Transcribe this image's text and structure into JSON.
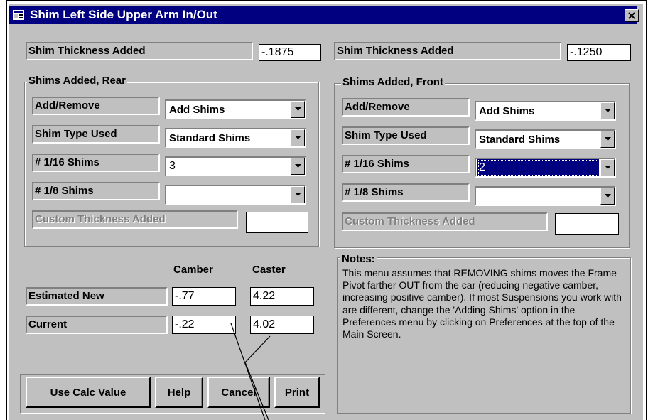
{
  "window": {
    "title": "Shim Left Side Upper Arm In/Out"
  },
  "rear": {
    "thickness_label": "Shim Thickness Added",
    "thickness_value": "-.1875",
    "group_title": "Shims Added, Rear",
    "add_remove_label": "Add/Remove",
    "add_remove_value": "Add Shims",
    "shim_type_label": "Shim Type Used",
    "shim_type_value": "Standard Shims",
    "sixteenth_label": "# 1/16 Shims",
    "sixteenth_value": "3",
    "eighth_label": "# 1/8 Shims",
    "eighth_value": "",
    "custom_label": "Custom Thickness Added",
    "custom_value": ""
  },
  "front": {
    "thickness_label": "Shim Thickness Added",
    "thickness_value": "-.1250",
    "group_title": "Shims Added, Front",
    "add_remove_label": "Add/Remove",
    "add_remove_value": "Add Shims",
    "shim_type_label": "Shim Type Used",
    "shim_type_value": "Standard Shims",
    "sixteenth_label": "# 1/16 Shims",
    "sixteenth_value": "2",
    "eighth_label": "# 1/8 Shims",
    "eighth_value": "",
    "custom_label": "Custom Thickness Added",
    "custom_value": ""
  },
  "results": {
    "camber_header": "Camber",
    "caster_header": "Caster",
    "estimated_label": "Estimated New",
    "estimated_camber": "-.77",
    "estimated_caster": "4.22",
    "current_label": "Current",
    "current_camber": "-.22",
    "current_caster": "4.02"
  },
  "notes": {
    "title": "Notes:",
    "text": "This menu assumes that REMOVING shims moves the Frame Pivot farther OUT from the car (reducing negative camber, increasing positive camber).  If most Suspensions you work with are different, change the 'Adding Shims' option in the Preferences menu by clicking on Preferences at the top of the Main Screen."
  },
  "buttons": {
    "use_calc": "Use Calc Value",
    "help": "Help",
    "cancel": "Cancel",
    "print": "Print"
  },
  "colors": {
    "titlebar": "#000080",
    "face": "#c0c0c0",
    "selection": "#000080"
  },
  "icons": {
    "app": "window-app-icon",
    "close": "close-icon",
    "dropdown": "chevron-down-icon"
  }
}
